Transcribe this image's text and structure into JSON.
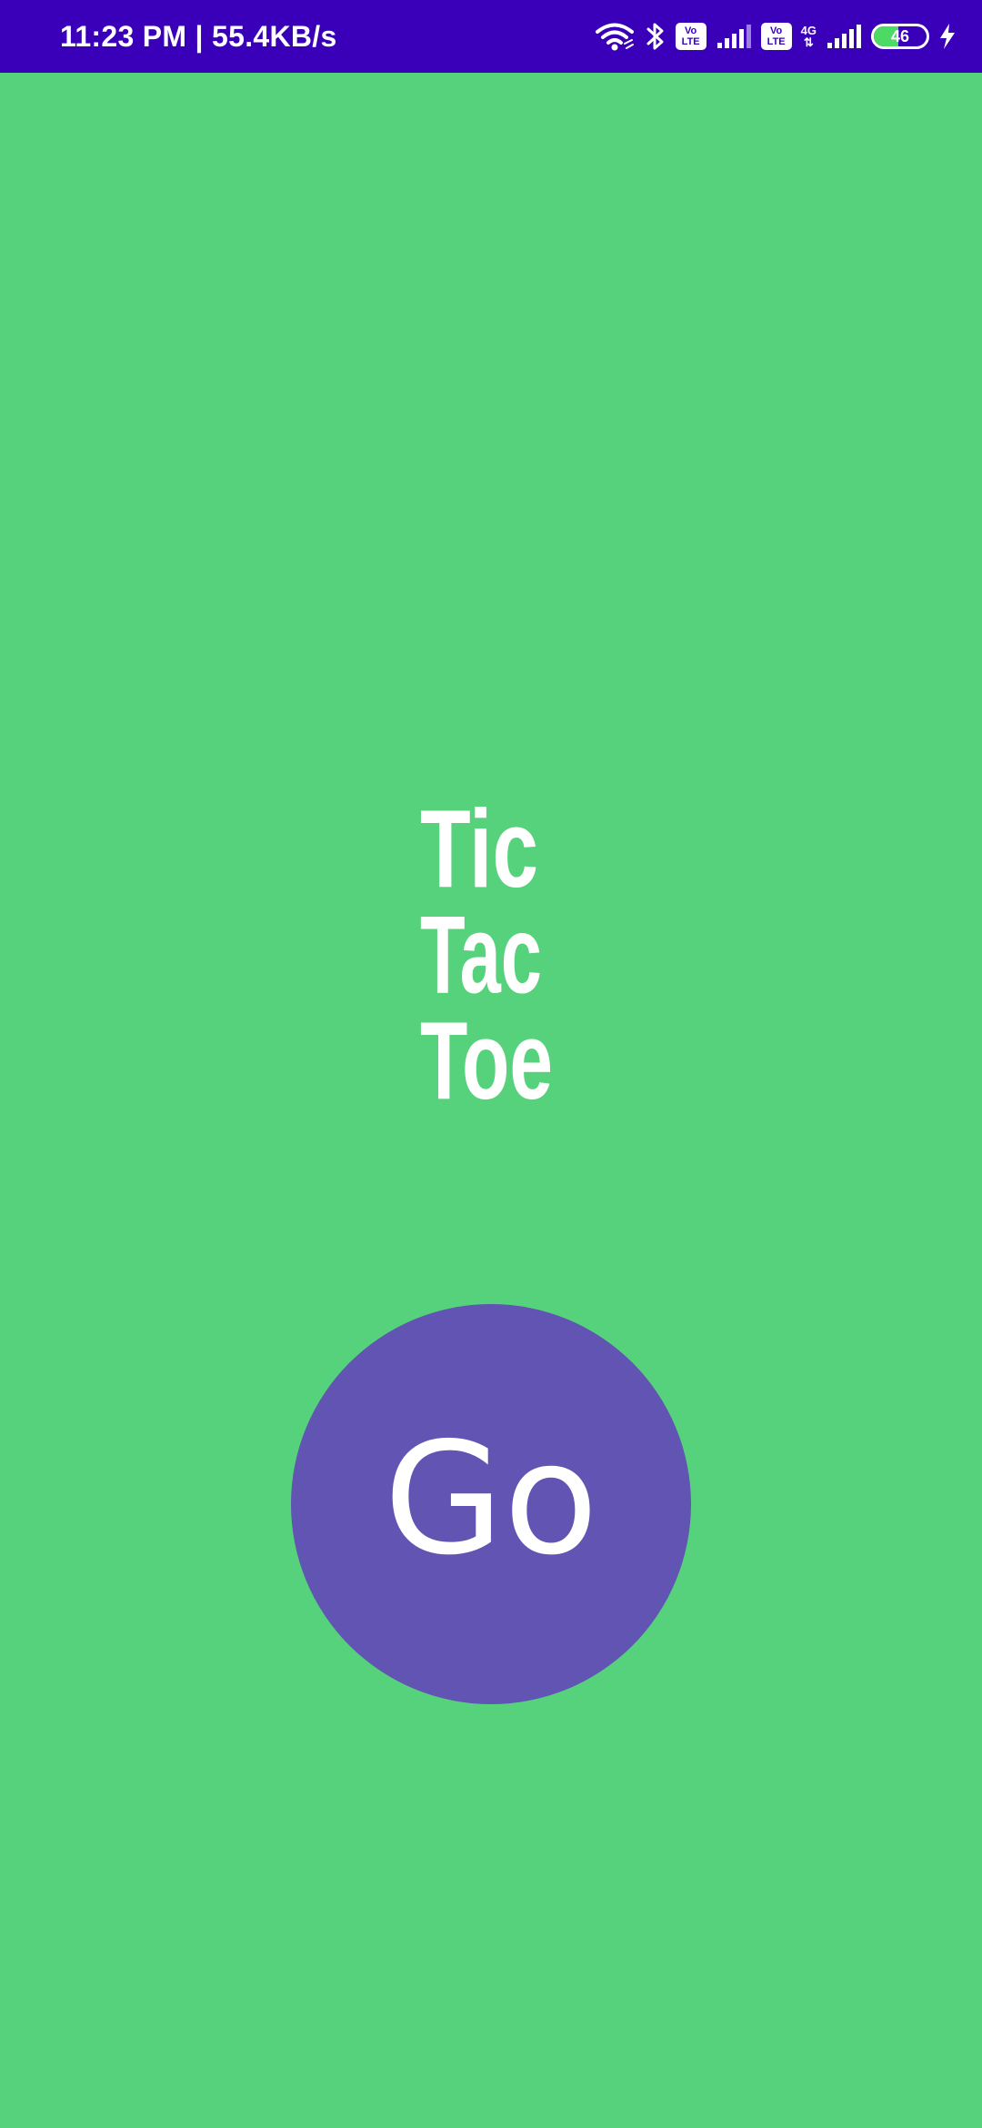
{
  "status_bar": {
    "time_and_speed": "11:23 PM | 55.4KB/s",
    "volte_top": "Vo",
    "volte_bottom": "LTE",
    "network_type": "4G",
    "battery_level": "46",
    "battery_fraction": 0.46
  },
  "logo": {
    "line1": "Tic",
    "line2": "Tac",
    "line3": "Toe"
  },
  "go_button": {
    "label": "Go"
  },
  "colors": {
    "status_bar_bg": "#3a00b9",
    "screen_bg": "#57d27c",
    "button_bg": "#6154b2",
    "text": "#ffffff"
  }
}
